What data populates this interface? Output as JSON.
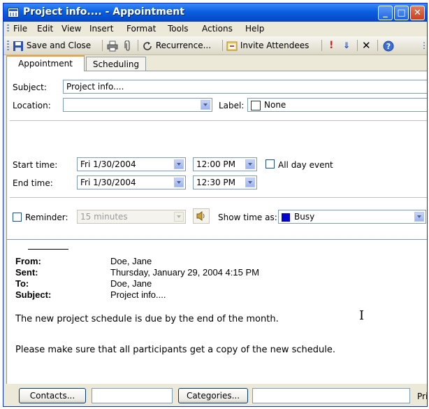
{
  "window": {
    "title": "Project info.... - Appointment",
    "min_glyph": "_",
    "max_glyph": "□",
    "close_glyph": "✕"
  },
  "menu": {
    "items": [
      "File",
      "Edit",
      "View",
      "Insert",
      "Format",
      "Tools",
      "Actions",
      "Help"
    ]
  },
  "toolbar": {
    "save_close": "Save and Close",
    "recurrence": "Recurrence...",
    "invite": "Invite Attendees"
  },
  "tabs": {
    "appointment": "Appointment",
    "scheduling": "Scheduling"
  },
  "form": {
    "subject_label": "Subject:",
    "subject_value": "Project info....",
    "location_label": "Location:",
    "location_value": "",
    "label_label": "Label:",
    "label_value": "None",
    "start_label": "Start time:",
    "start_date": "Fri 1/30/2004",
    "start_time": "12:00 PM",
    "allday_label": "All day event",
    "end_label": "End time:",
    "end_date": "Fri 1/30/2004",
    "end_time": "12:30 PM",
    "reminder_label": "Reminder:",
    "reminder_value": "15 minutes",
    "showtime_label": "Show time as:",
    "showtime_value": "Busy"
  },
  "message": {
    "from_label": "From:",
    "from_value": "Doe, Jane",
    "sent_label": "Sent:",
    "sent_value": "Thursday, January 29, 2004 4:15 PM",
    "to_label": "To:",
    "to_value": "Doe, Jane",
    "subject_label": "Subject:",
    "subject_value": "Project info....",
    "body_line1": "The new project schedule is due by the end of the month.",
    "body_line2": "Please make sure that all participants get a copy of the new schedule."
  },
  "bottom": {
    "contacts": "Contacts...",
    "categories": "Categories...",
    "private_partial": "Pri"
  },
  "colors": {
    "busy": "#0000cc",
    "accent_tab": "#f0a030"
  }
}
